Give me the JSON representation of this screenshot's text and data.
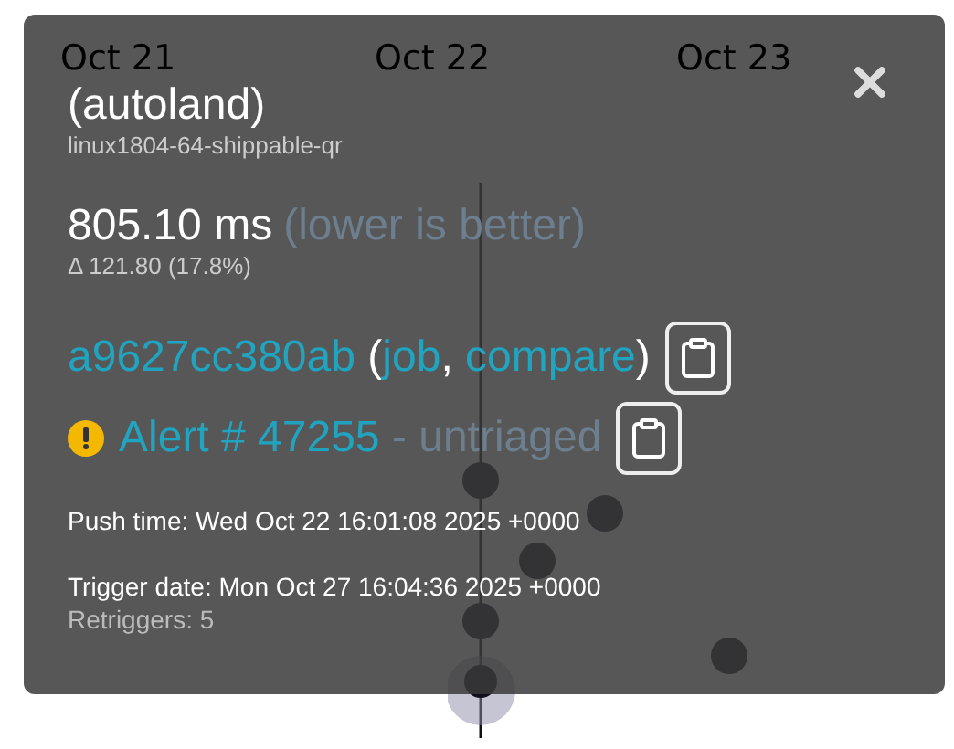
{
  "axis_labels": [
    "Oct 21",
    "Oct 22",
    "Oct 23"
  ],
  "title": "(autoland)",
  "platform": "linux1804-64-shippable-qr",
  "value": "805.10 ms",
  "value_note": "(lower is better)",
  "delta": "Δ 121.80 (17.8%)",
  "revision_parts": [
    {
      "text": "a9627cc380ab",
      "kind": "link"
    },
    {
      "text": " (",
      "kind": "plain"
    },
    {
      "text": "job",
      "kind": "link"
    },
    {
      "text": ", ",
      "kind": "plain"
    },
    {
      "text": "compare",
      "kind": "link"
    },
    {
      "text": ")",
      "kind": "plain"
    }
  ],
  "alert": {
    "link": "Alert # 47255",
    "status": " - untriaged"
  },
  "push_time": "Push time: Wed Oct 22 16:01:08 2025 +0000",
  "trigger_date": "Trigger date: Mon Oct 27 16:04:36 2025 +0000",
  "retriggers": "Retriggers: 5"
}
